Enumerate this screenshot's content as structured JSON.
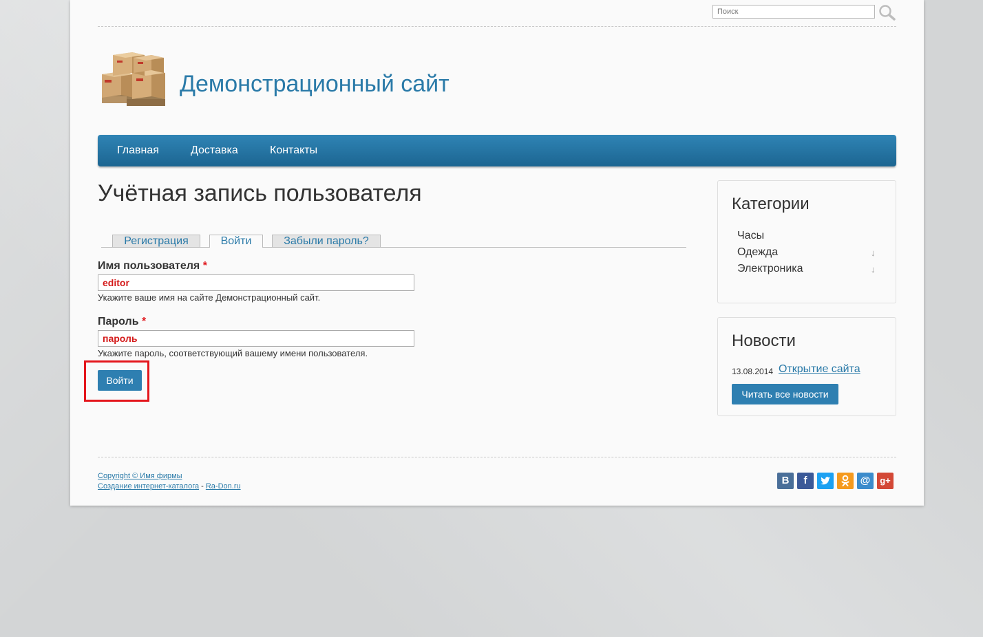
{
  "search": {
    "placeholder": "Поиск"
  },
  "header": {
    "site_title": "Демонстрационный сайт"
  },
  "nav": {
    "items": [
      "Главная",
      "Доставка",
      "Контакты"
    ]
  },
  "main": {
    "page_title": "Учётная запись пользователя",
    "tabs": [
      {
        "label": "Регистрация",
        "active": false
      },
      {
        "label": "Войти",
        "active": true
      },
      {
        "label": "Забыли пароль?",
        "active": false
      }
    ],
    "username": {
      "label": "Имя пользователя",
      "required_mark": "*",
      "value": "editor",
      "hint": "Укажите ваше имя на сайте Демонстрационный сайт."
    },
    "password": {
      "label": "Пароль",
      "required_mark": "*",
      "value": "пароль",
      "hint": "Укажите пароль, соответствующий вашему имени пользователя."
    },
    "submit_label": "Войти"
  },
  "sidebar": {
    "categories": {
      "title": "Категории",
      "items": [
        "Часы",
        "Одежда",
        "Электроника"
      ],
      "expand_icon": "↓"
    },
    "news": {
      "title": "Новости",
      "date": "13.08.2014",
      "link": "Открытие сайта",
      "button": "Читать все новости"
    }
  },
  "footer": {
    "copyright": "Copyright © Имя фирмы",
    "creation_link": "Создание интернет-каталога",
    "separator": " - ",
    "site_link": "Ra-Don.ru",
    "social_icons": [
      "vk-icon",
      "facebook-icon",
      "twitter-icon",
      "odnoklassniki-icon",
      "mailru-icon",
      "googleplus-icon"
    ]
  },
  "colors": {
    "accent": "#2a7aa8",
    "nav": "#2474a3",
    "highlight": "#e4161c",
    "input_text": "#d41a1a"
  }
}
